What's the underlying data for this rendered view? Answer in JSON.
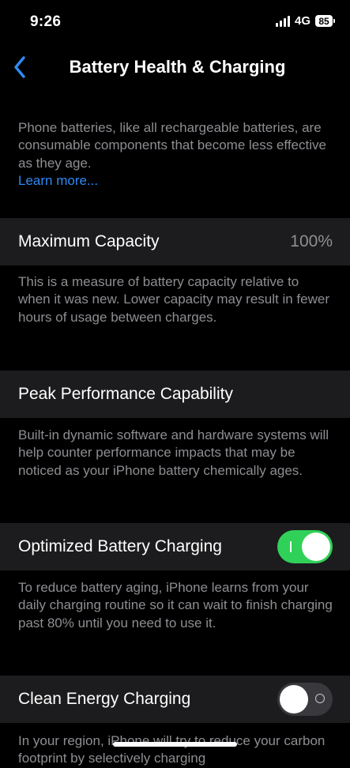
{
  "status_bar": {
    "time": "9:26",
    "network": "4G",
    "battery": "85"
  },
  "nav": {
    "title": "Battery Health & Charging"
  },
  "intro": {
    "text": "Phone batteries, like all rechargeable batteries, are consumable components that become less effective as they age.",
    "link": "Learn more..."
  },
  "max_capacity": {
    "label": "Maximum Capacity",
    "value": "100%",
    "description": "This is a measure of battery capacity relative to when it was new. Lower capacity may result in fewer hours of usage between charges."
  },
  "peak_performance": {
    "label": "Peak Performance Capability",
    "description": "Built-in dynamic software and hardware systems will help counter performance impacts that may be noticed as your iPhone battery chemically ages."
  },
  "optimized_charging": {
    "label": "Optimized Battery Charging",
    "enabled": true,
    "description": "To reduce battery aging, iPhone learns from your daily charging routine so it can wait to finish charging past 80% until you need to use it."
  },
  "clean_energy": {
    "label": "Clean Energy Charging",
    "enabled": false,
    "description": "In your region, iPhone will try to reduce your carbon footprint by selectively charging"
  },
  "colors": {
    "accent": "#2f8af5",
    "toggle_on": "#30d158",
    "cell_bg": "#1c1c1e",
    "secondary_text": "#8e8e93"
  }
}
